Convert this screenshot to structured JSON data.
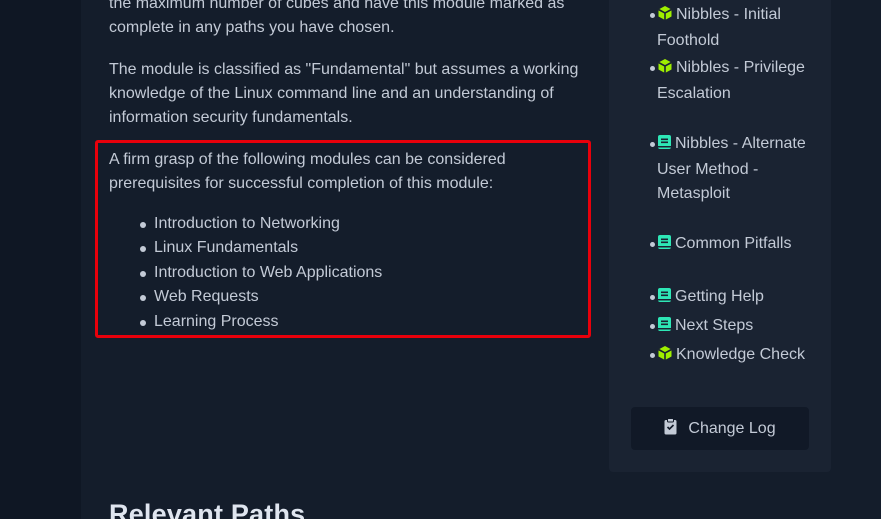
{
  "content": {
    "paragraph_1": "the maximum number of cubes and have this module marked as complete in any paths you have chosen.",
    "paragraph_2": "The module is classified as \"Fundamental\" but assumes a working knowledge of the Linux command line and an understanding of information security fundamentals.",
    "paragraph_3": "A firm grasp of the following modules can be considered prerequisites for successful completion of this module:",
    "prerequisites": [
      "Introduction to Networking",
      "Linux Fundamentals",
      "Introduction to Web Applications",
      "Web Requests",
      "Learning Process"
    ],
    "section_heading": "Relevant Paths"
  },
  "sidebar": {
    "toc": [
      {
        "label": "Nibbles - Initial Foothold",
        "icon": "cube-icon"
      },
      {
        "label": "Nibbles - Privilege Escalation",
        "icon": "cube-icon"
      },
      {
        "label": "Nibbles - Alternate User Method - Metasploit",
        "icon": "book-icon"
      },
      {
        "label": "Common Pitfalls",
        "icon": "book-icon"
      },
      {
        "label": "Getting Help",
        "icon": "book-icon"
      },
      {
        "label": "Next Steps",
        "icon": "book-icon"
      },
      {
        "label": "Knowledge Check",
        "icon": "cube-icon"
      }
    ],
    "changelog_label": "Change Log",
    "changelog_icon": "clipboard-icon"
  },
  "colors": {
    "accent_green": "#9fef00",
    "accent_teal": "#2ee7b6",
    "highlight_red": "#e8000b",
    "panel_bg": "#141d2b"
  }
}
